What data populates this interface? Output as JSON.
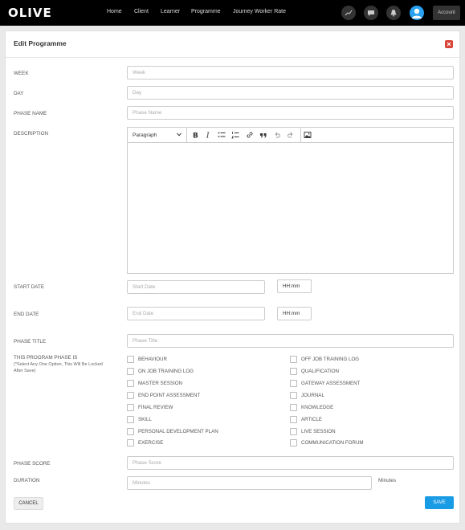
{
  "app": {
    "logo": "OLIVE"
  },
  "nav": {
    "links": [
      "Home",
      "Client",
      "Learner",
      "Programme",
      "Journey Worker Rate"
    ],
    "account_label": "Account",
    "icons": [
      "chart-icon",
      "chat-icon",
      "bell-icon"
    ]
  },
  "form": {
    "title": "Edit Programme",
    "week": {
      "label": "WEEK",
      "placeholder": "Week"
    },
    "day": {
      "label": "DAY",
      "placeholder": "Day"
    },
    "phase_name": {
      "label": "PHASE NAME",
      "placeholder": "Phase Name"
    },
    "description": {
      "label": "DESCRIPTION",
      "format": "Paragraph"
    },
    "start_date": {
      "label": "START DATE",
      "placeholder": "Start Date",
      "time": "HH:mm"
    },
    "end_date": {
      "label": "END DATE",
      "placeholder": "End Date",
      "time": "HH:mm"
    },
    "phase_title": {
      "label": "PHASE TITLE",
      "placeholder": "Phase Title"
    },
    "program_phase": {
      "label": "THIS PROGRAM PHASE IS",
      "note": "(*Select Any One Option, This Will Be Locked After Save)",
      "left": [
        "BEHAVIOUR",
        "ON JOB TRAINING LOG",
        "MASTER SESSION",
        "END POINT ASSESSMENT",
        "FINAL REVIEW",
        "SKILL",
        "PERSONAL DEVELOPMENT PLAN",
        "EXERCISE"
      ],
      "right": [
        "OFF JOB TRAINING LOG",
        "QUALIFICATION",
        "GATEWAY ASSESSMENT",
        "JOURNAL",
        "KNOWLEDGE",
        "ARTICLE",
        "LIVE SESSION",
        "COMMUNICATION FORUM"
      ]
    },
    "phase_score": {
      "label": "PHASE SCORE",
      "placeholder": "Phase Score"
    },
    "duration": {
      "label": "DURATION",
      "placeholder": "Minutes",
      "unit": "Minutes"
    },
    "cancel_label": "CANCEL",
    "save_label": "SAVE"
  },
  "colors": {
    "accent": "#1a9be6",
    "close": "#d9443a",
    "topbar": "#000000"
  }
}
